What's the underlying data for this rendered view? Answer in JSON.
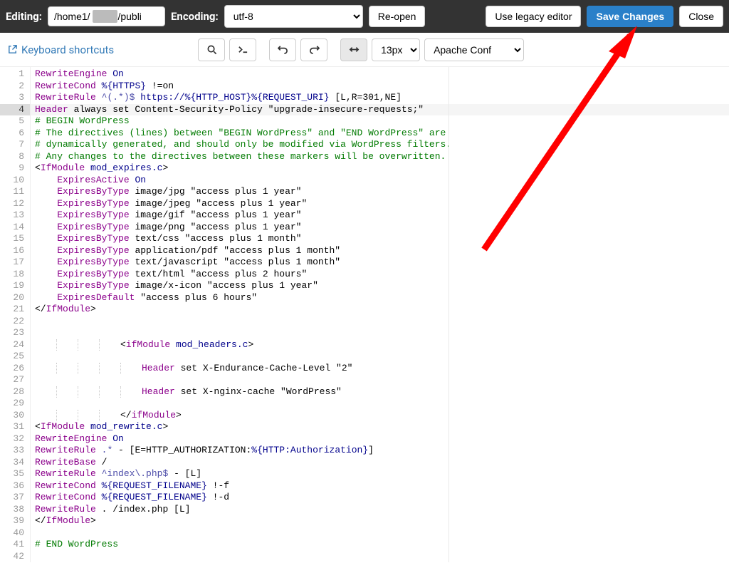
{
  "header": {
    "editing_label": "Editing:",
    "path_prefix": "/home1/",
    "path_blur": "          ",
    "path_suffix": "/publi",
    "encoding_label": "Encoding:",
    "encoding_value": "utf-8",
    "reopen_label": "Re-open",
    "legacy_label": "Use legacy editor",
    "save_label": "Save Changes",
    "close_label": "Close"
  },
  "toolbar": {
    "keyboard_shortcuts": "Keyboard shortcuts",
    "font_size": "13px",
    "syntax_mode": "Apache Conf"
  },
  "editor": {
    "current_line": 4,
    "lines": [
      {
        "n": 1,
        "tokens": [
          [
            "t-dir",
            "RewriteEngine"
          ],
          [
            "",
            " "
          ],
          [
            "t-var",
            "On"
          ]
        ]
      },
      {
        "n": 2,
        "tokens": [
          [
            "t-dir",
            "RewriteCond"
          ],
          [
            "",
            " "
          ],
          [
            "t-var",
            "%{HTTPS}"
          ],
          [
            "",
            " !=on"
          ]
        ]
      },
      {
        "n": 3,
        "tokens": [
          [
            "t-dir",
            "RewriteRule"
          ],
          [
            "",
            " "
          ],
          [
            "t-fn",
            "^(.*)$"
          ],
          [
            "",
            " "
          ],
          [
            "t-var",
            "https://%{HTTP_HOST}%{REQUEST_URI}"
          ],
          [
            "",
            " [L,R=301,NE]"
          ]
        ]
      },
      {
        "n": 4,
        "cur": true,
        "tokens": [
          [
            "t-dir",
            "Header"
          ],
          [
            "",
            " always set Content-Security-Policy \"upgrade-insecure-requests;\""
          ]
        ]
      },
      {
        "n": 5,
        "tokens": [
          [
            "t-cm",
            "# BEGIN WordPress"
          ]
        ]
      },
      {
        "n": 6,
        "tokens": [
          [
            "t-cm",
            "# The directives (lines) between \"BEGIN WordPress\" and \"END WordPress\" are"
          ]
        ]
      },
      {
        "n": 7,
        "tokens": [
          [
            "t-cm",
            "# dynamically generated, and should only be modified via WordPress filters."
          ]
        ]
      },
      {
        "n": 8,
        "tokens": [
          [
            "t-cm",
            "# Any changes to the directives between these markers will be overwritten."
          ]
        ]
      },
      {
        "n": 9,
        "tokens": [
          [
            "",
            "<"
          ],
          [
            "t-kw",
            "IfModule"
          ],
          [
            "",
            " "
          ],
          [
            "t-mod",
            "mod_expires.c"
          ],
          [
            "",
            ">"
          ]
        ]
      },
      {
        "n": 10,
        "tokens": [
          [
            "",
            "    "
          ],
          [
            "t-dir",
            "ExpiresActive"
          ],
          [
            "",
            " "
          ],
          [
            "t-var",
            "On"
          ]
        ]
      },
      {
        "n": 11,
        "tokens": [
          [
            "",
            "    "
          ],
          [
            "t-dir",
            "ExpiresByType"
          ],
          [
            "",
            " image/jpg \"access plus 1 year\""
          ]
        ]
      },
      {
        "n": 12,
        "tokens": [
          [
            "",
            "    "
          ],
          [
            "t-dir",
            "ExpiresByType"
          ],
          [
            "",
            " image/jpeg \"access plus 1 year\""
          ]
        ]
      },
      {
        "n": 13,
        "tokens": [
          [
            "",
            "    "
          ],
          [
            "t-dir",
            "ExpiresByType"
          ],
          [
            "",
            " image/gif \"access plus 1 year\""
          ]
        ]
      },
      {
        "n": 14,
        "tokens": [
          [
            "",
            "    "
          ],
          [
            "t-dir",
            "ExpiresByType"
          ],
          [
            "",
            " image/png \"access plus 1 year\""
          ]
        ]
      },
      {
        "n": 15,
        "tokens": [
          [
            "",
            "    "
          ],
          [
            "t-dir",
            "ExpiresByType"
          ],
          [
            "",
            " text/css \"access plus 1 month\""
          ]
        ]
      },
      {
        "n": 16,
        "tokens": [
          [
            "",
            "    "
          ],
          [
            "t-dir",
            "ExpiresByType"
          ],
          [
            "",
            " application/pdf \"access plus 1 month\""
          ]
        ]
      },
      {
        "n": 17,
        "tokens": [
          [
            "",
            "    "
          ],
          [
            "t-dir",
            "ExpiresByType"
          ],
          [
            "",
            " text/javascript \"access plus 1 month\""
          ]
        ]
      },
      {
        "n": 18,
        "tokens": [
          [
            "",
            "    "
          ],
          [
            "t-dir",
            "ExpiresByType"
          ],
          [
            "",
            " text/html \"access plus 2 hours\""
          ]
        ]
      },
      {
        "n": 19,
        "tokens": [
          [
            "",
            "    "
          ],
          [
            "t-dir",
            "ExpiresByType"
          ],
          [
            "",
            " image/x-icon \"access plus 1 year\""
          ]
        ]
      },
      {
        "n": 20,
        "tokens": [
          [
            "",
            "    "
          ],
          [
            "t-dir",
            "ExpiresDefault"
          ],
          [
            "",
            " \"access plus 6 hours\""
          ]
        ]
      },
      {
        "n": 21,
        "tokens": [
          [
            "",
            "</"
          ],
          [
            "t-kw",
            "IfModule"
          ],
          [
            "",
            ">"
          ]
        ]
      },
      {
        "n": 22,
        "tokens": [
          [
            "",
            ""
          ]
        ]
      },
      {
        "n": 23,
        "tokens": [
          [
            "",
            ""
          ]
        ]
      },
      {
        "n": 24,
        "indent": 4,
        "tokens": [
          [
            "",
            "<"
          ],
          [
            "t-kw",
            "ifModule"
          ],
          [
            "",
            " "
          ],
          [
            "t-mod",
            "mod_headers.c"
          ],
          [
            "",
            ">"
          ]
        ]
      },
      {
        "n": 25,
        "tokens": [
          [
            "",
            ""
          ]
        ]
      },
      {
        "n": 26,
        "indent": 5,
        "tokens": [
          [
            "t-dir",
            "Header"
          ],
          [
            "",
            " set X-Endurance-Cache-Level \"2\""
          ]
        ]
      },
      {
        "n": 27,
        "tokens": [
          [
            "",
            ""
          ]
        ]
      },
      {
        "n": 28,
        "indent": 5,
        "tokens": [
          [
            "t-dir",
            "Header"
          ],
          [
            "",
            " set X-nginx-cache \"WordPress\""
          ]
        ]
      },
      {
        "n": 29,
        "tokens": [
          [
            "",
            ""
          ]
        ]
      },
      {
        "n": 30,
        "indent": 4,
        "tokens": [
          [
            "",
            "</"
          ],
          [
            "t-kw",
            "ifModule"
          ],
          [
            "",
            ">"
          ]
        ]
      },
      {
        "n": 31,
        "tokens": [
          [
            "",
            "<"
          ],
          [
            "t-kw",
            "IfModule"
          ],
          [
            "",
            " "
          ],
          [
            "t-mod",
            "mod_rewrite.c"
          ],
          [
            "",
            ">"
          ]
        ]
      },
      {
        "n": 32,
        "tokens": [
          [
            "t-dir",
            "RewriteEngine"
          ],
          [
            "",
            " "
          ],
          [
            "t-var",
            "On"
          ]
        ]
      },
      {
        "n": 33,
        "tokens": [
          [
            "t-dir",
            "RewriteRule"
          ],
          [
            "",
            " "
          ],
          [
            "t-fn",
            ".*"
          ],
          [
            "",
            " - [E=HTTP_AUTHORIZATION:"
          ],
          [
            "t-var",
            "%{HTTP:Authorization}"
          ],
          [
            "",
            "]"
          ]
        ]
      },
      {
        "n": 34,
        "tokens": [
          [
            "t-dir",
            "RewriteBase"
          ],
          [
            "",
            " /"
          ]
        ]
      },
      {
        "n": 35,
        "tokens": [
          [
            "t-dir",
            "RewriteRule"
          ],
          [
            "",
            " "
          ],
          [
            "t-fn",
            "^index\\.php$"
          ],
          [
            "",
            " - [L]"
          ]
        ]
      },
      {
        "n": 36,
        "tokens": [
          [
            "t-dir",
            "RewriteCond"
          ],
          [
            "",
            " "
          ],
          [
            "t-var",
            "%{REQUEST_FILENAME}"
          ],
          [
            "",
            " !-f"
          ]
        ]
      },
      {
        "n": 37,
        "tokens": [
          [
            "t-dir",
            "RewriteCond"
          ],
          [
            "",
            " "
          ],
          [
            "t-var",
            "%{REQUEST_FILENAME}"
          ],
          [
            "",
            " !-d"
          ]
        ]
      },
      {
        "n": 38,
        "tokens": [
          [
            "t-dir",
            "RewriteRule"
          ],
          [
            "",
            " . /index.php [L]"
          ]
        ]
      },
      {
        "n": 39,
        "tokens": [
          [
            "",
            "</"
          ],
          [
            "t-kw",
            "IfModule"
          ],
          [
            "",
            ">"
          ]
        ]
      },
      {
        "n": 40,
        "tokens": [
          [
            "",
            ""
          ]
        ]
      },
      {
        "n": 41,
        "tokens": [
          [
            "t-cm",
            "# END WordPress"
          ]
        ]
      },
      {
        "n": 42,
        "tokens": [
          [
            "",
            ""
          ]
        ]
      }
    ]
  }
}
